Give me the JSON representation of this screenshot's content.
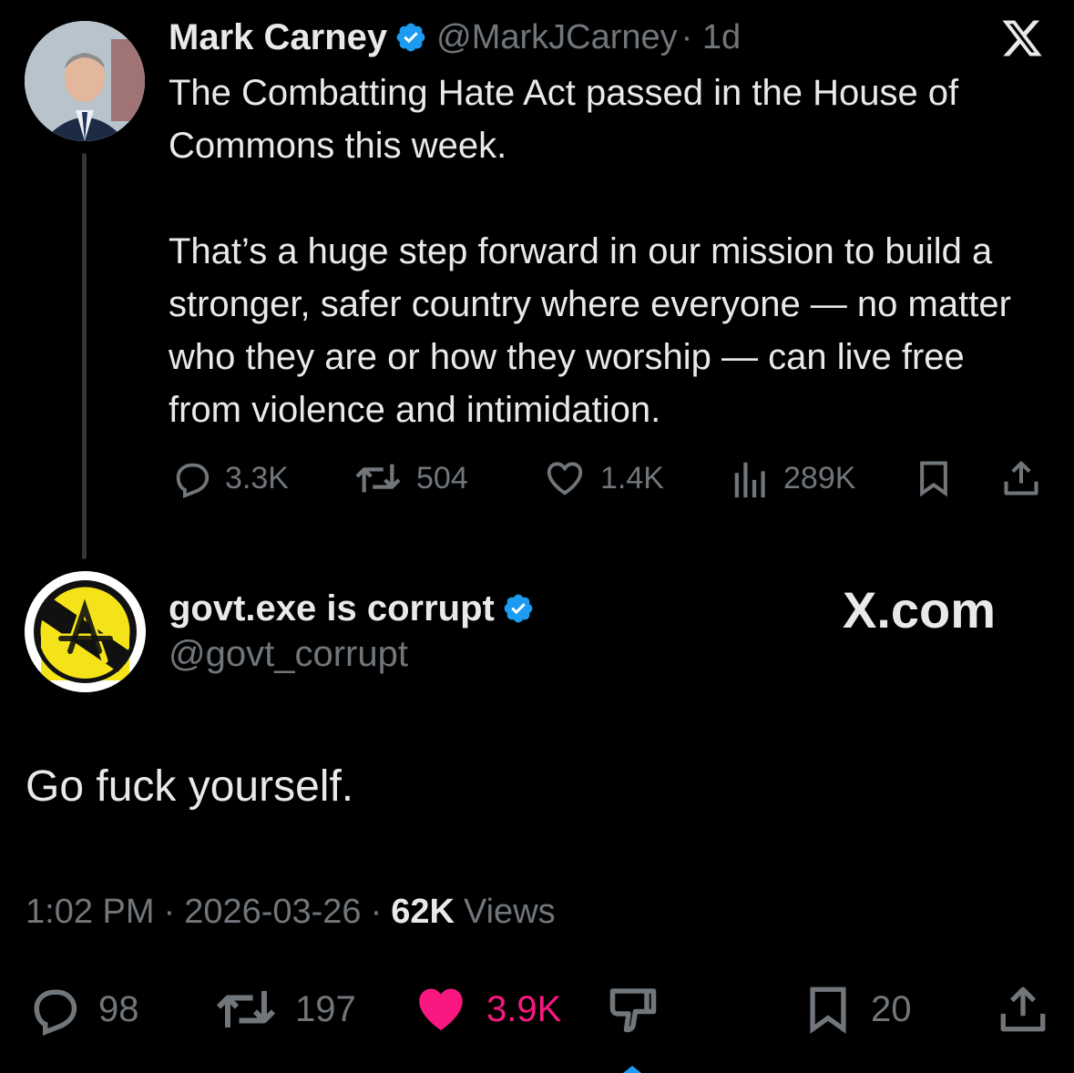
{
  "parent_tweet": {
    "author_name": "Mark Carney",
    "author_handle": "@MarkJCarney",
    "age": "· 1d",
    "text": "The Combatting Hate Act passed in the House of Commons this week.\n\nThat’s a huge step forward in our mission to build a stronger, safer country where everyone — no matter who they are or how they worship — can live free from violence and intimidation.",
    "stats": {
      "replies": "3.3K",
      "reposts": "504",
      "likes": "1.4K",
      "views": "289K"
    }
  },
  "reply_tweet": {
    "author_name": "govt.exe is corrupt",
    "author_handle": "@govt_corrupt",
    "text": "Go fuck yourself.",
    "time": "1:02 PM",
    "date": "2026-03-26",
    "views_count": "62K",
    "views_label": "Views",
    "stats": {
      "replies": "98",
      "reposts": "197",
      "likes": "3.9K",
      "bookmarks": "20"
    }
  },
  "watermark": "X.com",
  "colors": {
    "background": "#000000",
    "text": "#e7e9ea",
    "muted": "#71767b",
    "verified": "#1d9bf0",
    "like": "#f91880",
    "avatar_yellow": "#f5e31a"
  }
}
